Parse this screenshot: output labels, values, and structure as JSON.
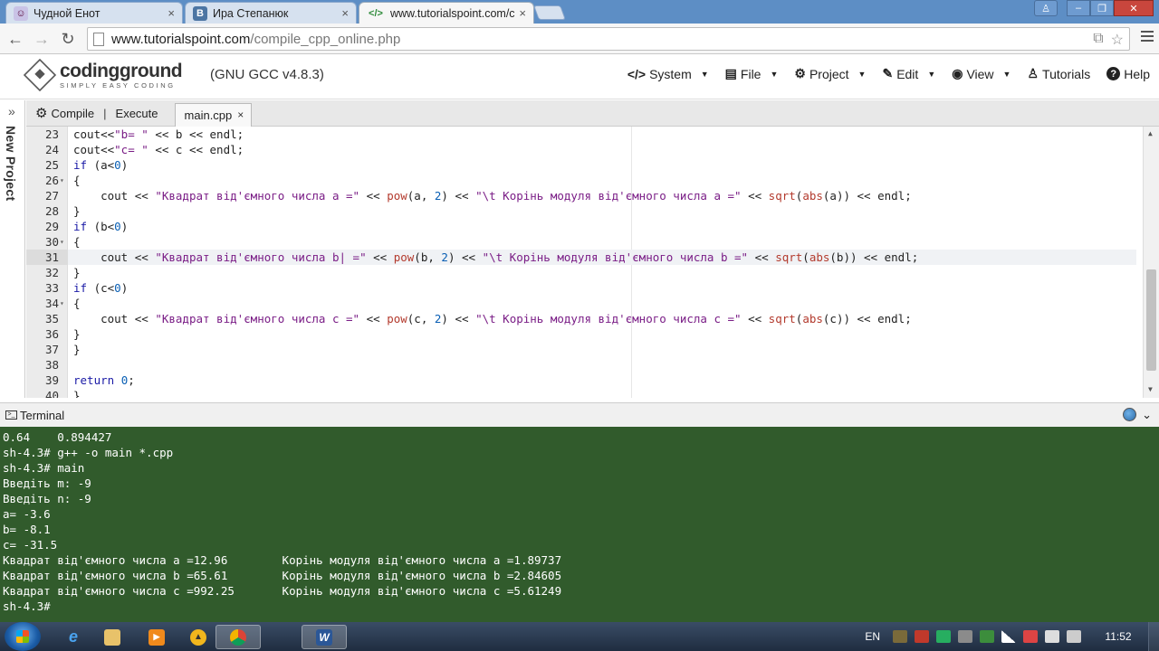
{
  "browser": {
    "tabs": [
      {
        "title": "Чудной Енот",
        "favicon": "cat-icon",
        "close": "×"
      },
      {
        "title": "Ира Степанюк",
        "favicon": "vk-icon",
        "favicon_text": "В",
        "close": "×"
      },
      {
        "title": "www.tutorialspoint.com/c",
        "favicon": "code-brackets-icon",
        "favicon_text": "</>",
        "close": "×",
        "active": true
      }
    ],
    "url_host": "www.tutorialspoint.com",
    "url_path": "/compile_cpp_online.php"
  },
  "site": {
    "logo_name": "codingground",
    "logo_tagline": "SIMPLY EASY CODING",
    "compiler_version": "(GNU GCC v4.8.3)",
    "menu": [
      {
        "label": "System",
        "icon": "code-icon",
        "glyph": "</>",
        "has_caret": true
      },
      {
        "label": "File",
        "icon": "file-icon",
        "glyph": "▤",
        "has_caret": true
      },
      {
        "label": "Project",
        "icon": "gear-icon",
        "glyph": "⚙",
        "has_caret": true
      },
      {
        "label": "Edit",
        "icon": "edit-icon",
        "glyph": "✎",
        "has_caret": true
      },
      {
        "label": "View",
        "icon": "eye-icon",
        "glyph": "◉",
        "has_caret": true
      },
      {
        "label": "Tutorials",
        "icon": "user-tutorials-icon",
        "glyph": "♙",
        "has_caret": false
      },
      {
        "label": "Help",
        "icon": "help-icon",
        "glyph": "?",
        "has_caret": false
      }
    ]
  },
  "project_rail": {
    "label": "New Project",
    "arrow": "»"
  },
  "editor_bar": {
    "compile_label": "Compile",
    "separator": "|",
    "execute_label": "Execute",
    "file_tab": "main.cpp",
    "file_tab_close": "×"
  },
  "editor": {
    "current_line": 31,
    "lines": [
      {
        "n": "23",
        "fold": "",
        "tokens": [
          [
            "",
            "cout<<"
          ],
          [
            "str",
            "\"b= \""
          ],
          [
            "",
            " << b << endl;"
          ]
        ]
      },
      {
        "n": "24",
        "fold": "",
        "tokens": [
          [
            "",
            "cout<<"
          ],
          [
            "str",
            "\"c= \""
          ],
          [
            "",
            " << c << endl;"
          ]
        ]
      },
      {
        "n": "25",
        "fold": "",
        "tokens": [
          [
            "kw",
            "if"
          ],
          [
            "",
            " (a<"
          ],
          [
            "num",
            "0"
          ],
          [
            "",
            ")"
          ]
        ]
      },
      {
        "n": "26",
        "fold": "▾",
        "tokens": [
          [
            "",
            "{"
          ]
        ]
      },
      {
        "n": "27",
        "fold": "",
        "tokens": [
          [
            "",
            "    cout << "
          ],
          [
            "str",
            "\"Квадрат від'ємного числа a =\""
          ],
          [
            "",
            " << "
          ],
          [
            "fn",
            "pow"
          ],
          [
            "",
            "(a, "
          ],
          [
            "num",
            "2"
          ],
          [
            "",
            ") << "
          ],
          [
            "str",
            "\"\\t Корінь модуля від'ємного числа a =\""
          ],
          [
            "",
            " << "
          ],
          [
            "fn",
            "sqrt"
          ],
          [
            "",
            "("
          ],
          [
            "fn",
            "abs"
          ],
          [
            "",
            "(a)) << endl;"
          ]
        ]
      },
      {
        "n": "28",
        "fold": "",
        "tokens": [
          [
            "",
            "}"
          ]
        ]
      },
      {
        "n": "29",
        "fold": "",
        "tokens": [
          [
            "kw",
            "if"
          ],
          [
            "",
            " (b<"
          ],
          [
            "num",
            "0"
          ],
          [
            "",
            ")"
          ]
        ]
      },
      {
        "n": "30",
        "fold": "▾",
        "tokens": [
          [
            "",
            "{"
          ]
        ]
      },
      {
        "n": "31",
        "fold": "",
        "tokens": [
          [
            "",
            "    cout << "
          ],
          [
            "str",
            "\"Квадрат від'ємного числа b| =\""
          ],
          [
            "",
            " << "
          ],
          [
            "fn",
            "pow"
          ],
          [
            "",
            "(b, "
          ],
          [
            "num",
            "2"
          ],
          [
            "",
            ") << "
          ],
          [
            "str",
            "\"\\t Корінь модуля від'ємного числа b =\""
          ],
          [
            "",
            " << "
          ],
          [
            "fn",
            "sqrt"
          ],
          [
            "",
            "("
          ],
          [
            "fn",
            "abs"
          ],
          [
            "",
            "(b)) << endl;"
          ]
        ]
      },
      {
        "n": "32",
        "fold": "",
        "tokens": [
          [
            "",
            "}"
          ]
        ]
      },
      {
        "n": "33",
        "fold": "",
        "tokens": [
          [
            "kw",
            "if"
          ],
          [
            "",
            " (c<"
          ],
          [
            "num",
            "0"
          ],
          [
            "",
            ")"
          ]
        ]
      },
      {
        "n": "34",
        "fold": "▾",
        "tokens": [
          [
            "",
            "{"
          ]
        ]
      },
      {
        "n": "35",
        "fold": "",
        "tokens": [
          [
            "",
            "    cout << "
          ],
          [
            "str",
            "\"Квадрат від'ємного числа c =\""
          ],
          [
            "",
            " << "
          ],
          [
            "fn",
            "pow"
          ],
          [
            "",
            "(c, "
          ],
          [
            "num",
            "2"
          ],
          [
            "",
            ") << "
          ],
          [
            "str",
            "\"\\t Корінь модуля від'ємного числа c =\""
          ],
          [
            "",
            " << "
          ],
          [
            "fn",
            "sqrt"
          ],
          [
            "",
            "("
          ],
          [
            "fn",
            "abs"
          ],
          [
            "",
            "(c)) << endl;"
          ]
        ]
      },
      {
        "n": "36",
        "fold": "",
        "tokens": [
          [
            "",
            "}"
          ]
        ]
      },
      {
        "n": "37",
        "fold": "",
        "tokens": [
          [
            "",
            "}"
          ]
        ]
      },
      {
        "n": "38",
        "fold": "",
        "tokens": [
          [
            "",
            ""
          ]
        ]
      },
      {
        "n": "39",
        "fold": "",
        "tokens": [
          [
            "kw",
            "return"
          ],
          [
            "",
            " "
          ],
          [
            "num",
            "0"
          ],
          [
            "",
            ";"
          ]
        ]
      },
      {
        "n": "40",
        "fold": "",
        "tokens": [
          [
            "",
            "}"
          ]
        ]
      }
    ]
  },
  "terminal": {
    "title": "Terminal",
    "lines": [
      "0.64    0.894427",
      "sh-4.3# g++ -o main *.cpp",
      "sh-4.3# main",
      "Введіть m: -9",
      "Введіть n: -9",
      "a= -3.6",
      "b= -8.1",
      "c= -31.5",
      "Квадрат від'ємного числа a =12.96        Корінь модуля від'ємного числа a =1.89737",
      "Квадрат від'ємного числа b =65.61        Корінь модуля від'ємного числа b =2.84605",
      "Квадрат від'ємного числа c =992.25       Корінь модуля від'ємного числа c =5.61249",
      "sh-4.3#"
    ]
  },
  "taskbar": {
    "language": "EN",
    "clock": "11:52"
  },
  "colors": {
    "terminal_bg": "#315b2c",
    "string": "#7a1d86",
    "keyword": "#1a1aa6",
    "function": "#b33a2d"
  }
}
